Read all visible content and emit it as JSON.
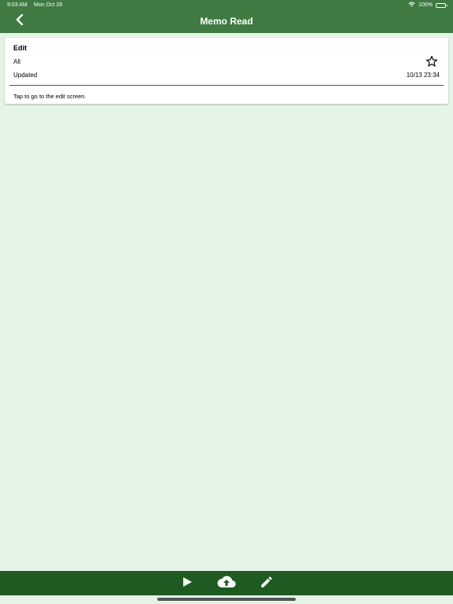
{
  "status_bar": {
    "time": "9:03 AM",
    "date": "Mon Oct 28",
    "battery": "100%"
  },
  "nav": {
    "title": "Memo Read"
  },
  "memo": {
    "title": "Edit",
    "category": "All",
    "updated_label": "Updated",
    "updated_value": "10/13 23:34",
    "body": "Tap to go to the edit screen."
  },
  "icons": {
    "back": "chevron-left-icon",
    "favorite": "star-outline-icon",
    "play": "play-icon",
    "upload": "cloud-upload-icon",
    "edit": "pencil-icon"
  },
  "colors": {
    "header_bg": "#3f7a42",
    "toolbar_bg": "#1f5a22",
    "page_bg": "#e5f4e7"
  }
}
